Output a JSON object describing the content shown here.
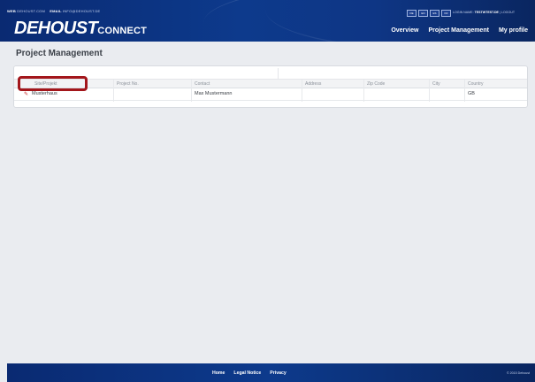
{
  "header": {
    "web_label": "WEB",
    "web_value": "DEHOUST.COM",
    "email_label": "EMAIL",
    "email_value": "INFO@DEHOUST.DE",
    "languages": [
      "DE",
      "EN",
      "ES",
      "FR"
    ],
    "login_label": "LOGIN NAME:",
    "login_value": "TESTWTEST.DE",
    "logout_label": "LOGOUT",
    "logo_main": "DEHOUST",
    "logo_suffix": "CONNECT",
    "nav": [
      "Overview",
      "Project Management",
      "My profile"
    ]
  },
  "page": {
    "title": "Project Management"
  },
  "table": {
    "columns": [
      "Site/Projekt",
      "Project No.",
      "Contact",
      "Address",
      "Zip Code",
      "City",
      "Country"
    ],
    "rows": [
      {
        "site": "Musterhaus",
        "project_no": "",
        "contact": "Max Mustermann",
        "address": "",
        "zip": "",
        "city": "",
        "country": "GB"
      }
    ]
  },
  "footer": {
    "links": [
      "Home",
      "Legal Notice",
      "Privacy"
    ],
    "copyright": "© 2015 Dehoust"
  },
  "colors": {
    "header_bg": "#0d3a8c",
    "highlight": "#a3161b",
    "edit_icon": "#c62b2b"
  }
}
